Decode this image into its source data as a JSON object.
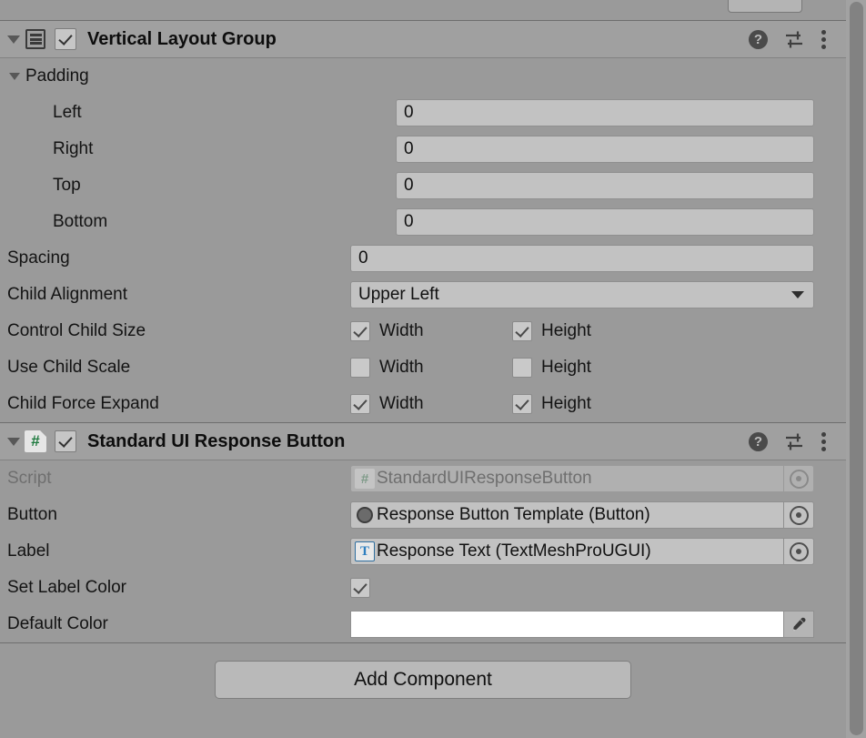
{
  "window": {
    "panel": "inspector"
  },
  "components": [
    {
      "id": "vertical-layout-group",
      "title": "Vertical Layout Group",
      "icon": "layout-vertical-icon",
      "enabled": true,
      "header_icons": {
        "help": "?",
        "preset": "preset-sliders-icon",
        "menu": "kebab-menu-icon"
      },
      "groups": [
        {
          "label": "Padding",
          "expanded": true,
          "rows": [
            {
              "label": "Left",
              "type": "number",
              "value": "0"
            },
            {
              "label": "Right",
              "type": "number",
              "value": "0"
            },
            {
              "label": "Top",
              "type": "number",
              "value": "0"
            },
            {
              "label": "Bottom",
              "type": "number",
              "value": "0"
            }
          ]
        }
      ],
      "rows": [
        {
          "label": "Spacing",
          "type": "number",
          "value": "0"
        },
        {
          "label": "Child Alignment",
          "type": "dropdown",
          "value": "Upper Left"
        },
        {
          "label": "Control Child Size",
          "type": "toggles",
          "toggles": [
            {
              "label": "Width",
              "checked": true
            },
            {
              "label": "Height",
              "checked": true
            }
          ]
        },
        {
          "label": "Use Child Scale",
          "type": "toggles",
          "toggles": [
            {
              "label": "Width",
              "checked": false
            },
            {
              "label": "Height",
              "checked": false
            }
          ]
        },
        {
          "label": "Child Force Expand",
          "type": "toggles",
          "toggles": [
            {
              "label": "Width",
              "checked": true
            },
            {
              "label": "Height",
              "checked": true
            }
          ]
        }
      ]
    },
    {
      "id": "standard-ui-response-button",
      "title": "Standard UI Response Button",
      "icon": "csharp-script-icon",
      "enabled": true,
      "header_icons": {
        "help": "?",
        "preset": "preset-sliders-icon",
        "menu": "kebab-menu-icon"
      },
      "rows": [
        {
          "label": "Script",
          "type": "object",
          "value": "StandardUIResponseButton",
          "value_icon": "csharp-script-icon",
          "disabled": true
        },
        {
          "label": "Button",
          "type": "object",
          "value": "Response Button Template (Button)",
          "value_icon": "button-component-icon",
          "disabled": false
        },
        {
          "label": "Label",
          "type": "object",
          "value": "Response Text (TextMeshProUGUI)",
          "value_icon": "textmeshpro-icon",
          "disabled": false
        },
        {
          "label": "Set Label Color",
          "type": "checkbox",
          "checked": true
        },
        {
          "label": "Default Color",
          "type": "color",
          "value": "#FFFFFF",
          "eyedropper": "eyedropper-icon"
        }
      ]
    }
  ],
  "footer": {
    "add_component_label": "Add Component"
  },
  "colors": {
    "panel_bg": "#9a9a9a",
    "header_bg": "#a0a0a0",
    "field_bg": "#c2c2c2",
    "default_color_swatch": "#FFFFFF",
    "csharp_accent": "#1f7a3f",
    "tmp_accent": "#2e7fc0"
  },
  "labels": {
    "mini_cs": "#",
    "mini_tmp": "T"
  }
}
